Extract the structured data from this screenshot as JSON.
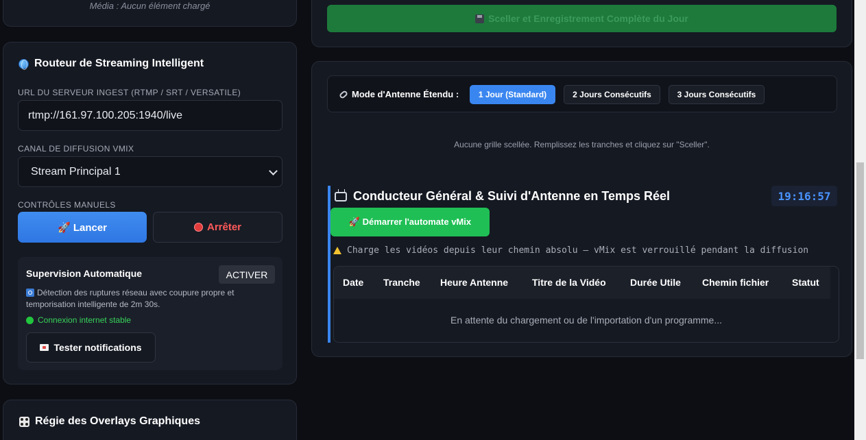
{
  "media": {
    "status": "Média : Aucun élément chargé"
  },
  "router": {
    "title": "Routeur de Streaming Intelligent",
    "icon": "globe-icon",
    "ingest_label": "URL DU SERVEUR INGEST (RTMP / SRT / VERSATILE)",
    "ingest_value": "rtmp://161.97.100.205:1940/live",
    "channel_label": "CANAL DE DIFFUSION VMIX",
    "channel_selected": "Stream Principal 1",
    "controls_label": "CONTRÔLES MANUELS",
    "launch_label": "🚀 Lancer",
    "stop_label": "Arrêter",
    "supervision": {
      "title": "Supervision Automatique",
      "activate_label": "ACTIVER",
      "description": "Détection des ruptures réseau avec coupure propre et temporisation intelligente de 2m 30s.",
      "connection_status": "Connexion internet stable",
      "test_label": "Tester notifications"
    }
  },
  "overlays": {
    "title": "Régie des Overlays Graphiques",
    "icon": "dice-icon"
  },
  "seal": {
    "button_label": "Sceller et Enregistrement Complète du Jour",
    "icon": "floppy-icon"
  },
  "antenna_mode": {
    "label": "Mode d'Antenne Étendu :",
    "options": [
      "1 Jour (Standard)",
      "2 Jours Consécutifs",
      "3 Jours Consécutifs"
    ],
    "selected": "1 Jour (Standard)"
  },
  "grid_status": "Aucune grille scellée. Remplissez les tranches et cliquez sur \"Sceller\".",
  "conductor": {
    "title": "Conducteur Général & Suivi d'Antenne en Temps Réel",
    "clock": "19:16:57",
    "start_label": "🚀 Démarrer l'automate vMix",
    "warning": "Charge les vidéos depuis leur chemin absolu — vMix est verrouillé pendant la diffusion",
    "columns": [
      "Date",
      "Tranche",
      "Heure Antenne",
      "Titre de la Vidéo",
      "Durée Utile",
      "Chemin fichier",
      "Statut"
    ],
    "empty_message": "En attente du chargement ou de l'importation d'un programme..."
  },
  "colors": {
    "accent": "#3a86f0",
    "success": "#1fbf55",
    "danger": "#e23b3b",
    "panel": "#151922",
    "background": "#0c0e13"
  }
}
